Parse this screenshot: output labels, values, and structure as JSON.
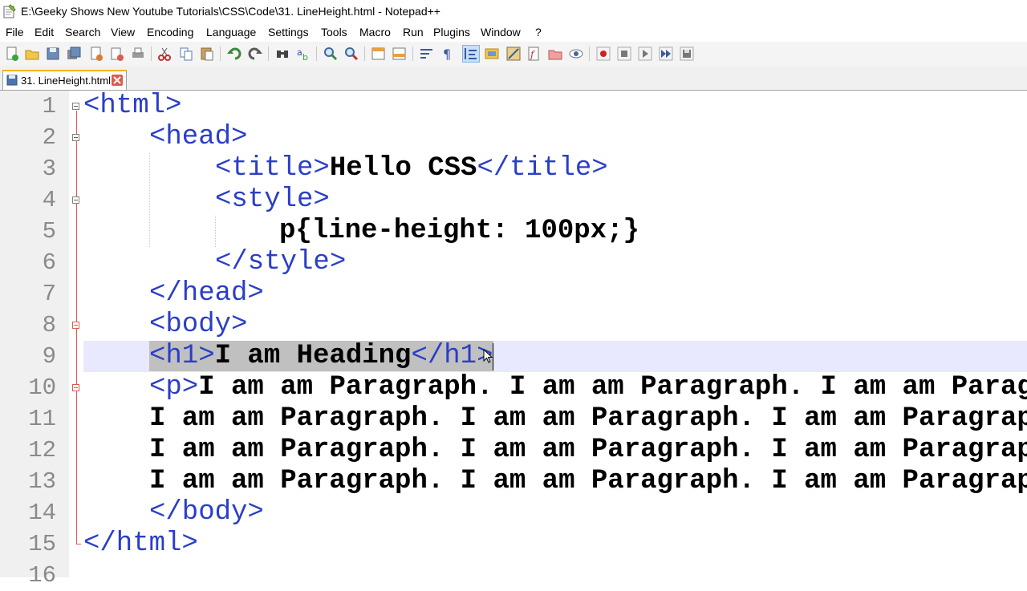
{
  "window": {
    "title": "E:\\Geeky Shows New Youtube Tutorials\\CSS\\Code\\31. LineHeight.html - Notepad++",
    "icon": "notepadpp-icon"
  },
  "menu": [
    "File",
    "Edit",
    "Search",
    "View",
    "Encoding",
    "Language",
    "Settings",
    "Tools",
    "Macro",
    "Run",
    "Plugins",
    "Window",
    "?"
  ],
  "tab": {
    "label": "31. LineHeight.html",
    "icon": "save-icon"
  },
  "editor": {
    "line_numbers": [
      "1",
      "2",
      "3",
      "4",
      "5",
      "6",
      "7",
      "8",
      "9",
      "10",
      "11",
      "12",
      "13",
      "14",
      "15",
      "16"
    ],
    "lines": [
      {
        "tag1": "<html>"
      },
      {
        "tag1": "<head>"
      },
      {
        "tag1": "<title>",
        "text": "Hello CSS",
        "tag2": "</title>"
      },
      {
        "tag1": "<style>"
      },
      {
        "text": "p{line-height: 100px;}"
      },
      {
        "tag1": "</style>"
      },
      {
        "tag1": "</head>"
      },
      {
        "tag1": "<body>"
      },
      {
        "tag1": "<h1>",
        "text": "I am Heading",
        "tag2": "</h1>"
      },
      {
        "tag1": "<p>",
        "text": "I am am Paragraph. I am am Paragraph. I am am Parag"
      },
      {
        "text": "I am am Paragraph. I am am Paragraph. I am am Paragrap"
      },
      {
        "text": "I am am Paragraph. I am am Paragraph. I am am Paragrap"
      },
      {
        "text": "I am am Paragraph. I am am Paragraph. I am am Paragrap"
      },
      {
        "tag1": "</body>"
      },
      {
        "tag1": "</html>"
      }
    ],
    "current_line": 9
  },
  "colors": {
    "tag": "#2a3ec7",
    "text": "#000000",
    "line_number": "#8a8a8a",
    "current_line_bg": "#e8e8ff",
    "fold_marker": "#e0584f"
  }
}
